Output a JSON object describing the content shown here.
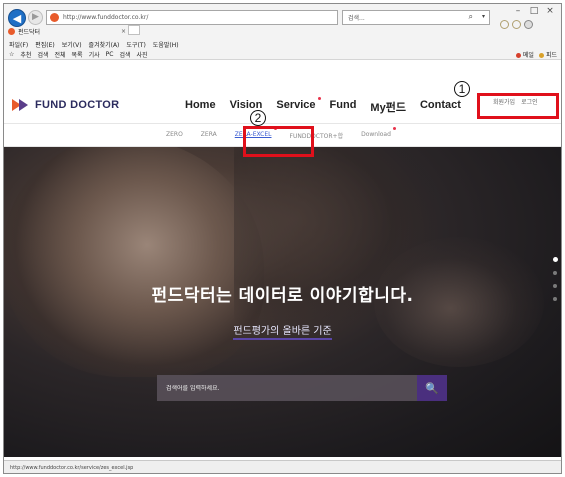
{
  "browser": {
    "address_url": "http://www.funddoctor.co.kr/",
    "address_tools": [
      "- C",
      "검색..."
    ],
    "search_placeholder": "검색...",
    "tab_title": "펀드닥터",
    "tab_close": "×",
    "menu": [
      "파일(F)",
      "편집(E)",
      "보기(V)",
      "즐겨찾기(A)",
      "도구(T)",
      "도움말(H)"
    ],
    "favorites": [
      "☆",
      "추천",
      "검색",
      "전체",
      "목록",
      "기사",
      "PC",
      "검색",
      "사진"
    ],
    "favorites_right": [
      "메일",
      "피드"
    ],
    "status_url": "http://www.funddoctor.co.kr/service/zes_excel.jsp",
    "window_controls": [
      "–",
      "□",
      "×"
    ]
  },
  "site": {
    "logo_text": "FUND DOCTOR",
    "nav": [
      {
        "label": "Home",
        "new": false
      },
      {
        "label": "Vision",
        "new": false
      },
      {
        "label": "Service",
        "new": true
      },
      {
        "label": "Fund",
        "new": false
      },
      {
        "label": "My펀드",
        "new": false
      },
      {
        "label": "Contact",
        "new": false
      }
    ],
    "auth": {
      "join": "회원가입",
      "login": "로그인"
    },
    "subnav": [
      {
        "label": "ZERO",
        "active": false,
        "new": false
      },
      {
        "label": "ZERA",
        "active": false,
        "new": false
      },
      {
        "label": "ZERA-EXCEL",
        "active": true,
        "new": true
      },
      {
        "label": "FUNDDOCTOR+합",
        "active": false,
        "new": false
      },
      {
        "label": "Download",
        "active": false,
        "new": true
      }
    ],
    "hero": {
      "title": "펀드닥터는 데이터로 이야기합니다.",
      "subtitle": "펀드평가의 올바른 기준",
      "search_placeholder": "검색어를 입력하세요.",
      "search_button": "🔍",
      "slides": 4,
      "active_slide": 0
    }
  },
  "annotations": {
    "marker_1": "1",
    "marker_2": "2"
  },
  "colors": {
    "accent_purple": "#4a2f7e",
    "logo_orange": "#e85b2b",
    "annotation_red": "#e0101b",
    "link_blue": "#3a5bd1"
  }
}
